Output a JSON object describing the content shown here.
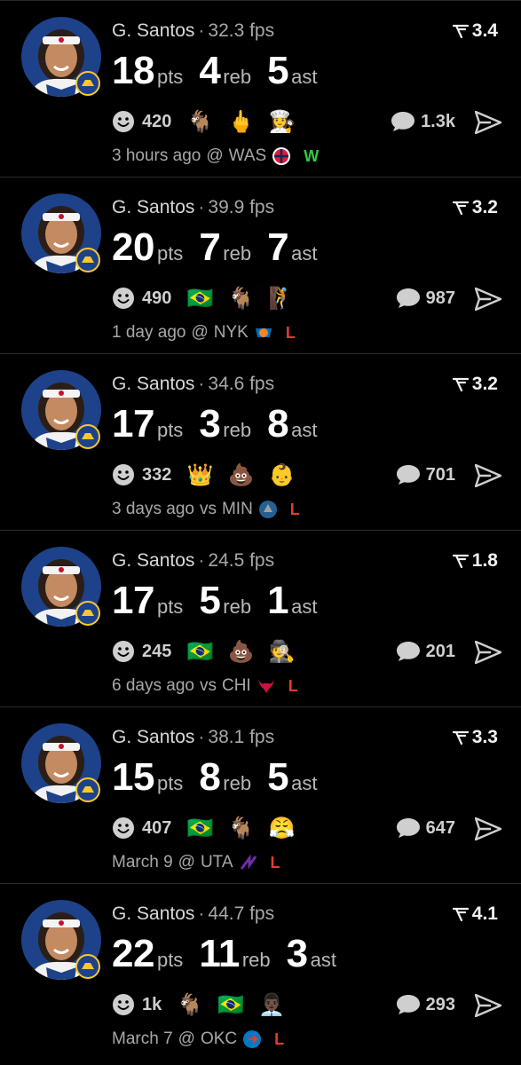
{
  "player": {
    "name": "G. Santos",
    "separator": "·"
  },
  "labels": {
    "pts": "pts",
    "reb": "reb",
    "ast": "ast"
  },
  "colors": {
    "background": "#000000",
    "win": "#2ecc40",
    "loss": "#e03c31",
    "warriors_blue": "#1d428a",
    "warriors_gold": "#ffc72c"
  },
  "icons": {
    "rating": "rating-funnel-icon",
    "reactions": "smile-icon",
    "comments": "comment-bubble-icon",
    "share": "share-arrow-icon"
  },
  "posts": [
    {
      "fps": "32.3 fps",
      "rating": "3.4",
      "pts": "18",
      "reb": "4",
      "ast": "5",
      "reaction_count": "420",
      "emojis": [
        "🐐",
        "🖕",
        "👩‍🍳"
      ],
      "comment_count": "1.3k",
      "time": "3 hours ago",
      "venue": "@",
      "opponent": "WAS",
      "opponent_logo": "wizards-logo-icon",
      "result": "W"
    },
    {
      "fps": "39.9 fps",
      "rating": "3.2",
      "pts": "20",
      "reb": "7",
      "ast": "7",
      "reaction_count": "490",
      "emojis": [
        "🇧🇷",
        "🐐",
        "🧗"
      ],
      "comment_count": "987",
      "time": "1 day ago",
      "venue": "@",
      "opponent": "NYK",
      "opponent_logo": "knicks-logo-icon",
      "result": "L"
    },
    {
      "fps": "34.6 fps",
      "rating": "3.2",
      "pts": "17",
      "reb": "3",
      "ast": "8",
      "reaction_count": "332",
      "emojis": [
        "👑",
        "💩",
        "👶"
      ],
      "comment_count": "701",
      "time": "3 days ago",
      "venue": "vs",
      "opponent": "MIN",
      "opponent_logo": "timberwolves-logo-icon",
      "result": "L"
    },
    {
      "fps": "24.5 fps",
      "rating": "1.8",
      "pts": "17",
      "reb": "5",
      "ast": "1",
      "reaction_count": "245",
      "emojis": [
        "🇧🇷",
        "💩",
        "🕵️"
      ],
      "comment_count": "201",
      "time": "6 days ago",
      "venue": "vs",
      "opponent": "CHI",
      "opponent_logo": "bulls-logo-icon",
      "result": "L"
    },
    {
      "fps": "38.1 fps",
      "rating": "3.3",
      "pts": "15",
      "reb": "8",
      "ast": "5",
      "reaction_count": "407",
      "emojis": [
        "🇧🇷",
        "🐐",
        "😤"
      ],
      "comment_count": "647",
      "time": "March 9",
      "venue": "@",
      "opponent": "UTA",
      "opponent_logo": "jazz-logo-icon",
      "result": "L"
    },
    {
      "fps": "44.7 fps",
      "rating": "4.1",
      "pts": "22",
      "reb": "11",
      "ast": "3",
      "reaction_count": "1k",
      "emojis": [
        "🐐",
        "🇧🇷",
        "👨🏿‍💼"
      ],
      "comment_count": "293",
      "time": "March 7",
      "venue": "@",
      "opponent": "OKC",
      "opponent_logo": "thunder-logo-icon",
      "result": "L"
    }
  ]
}
